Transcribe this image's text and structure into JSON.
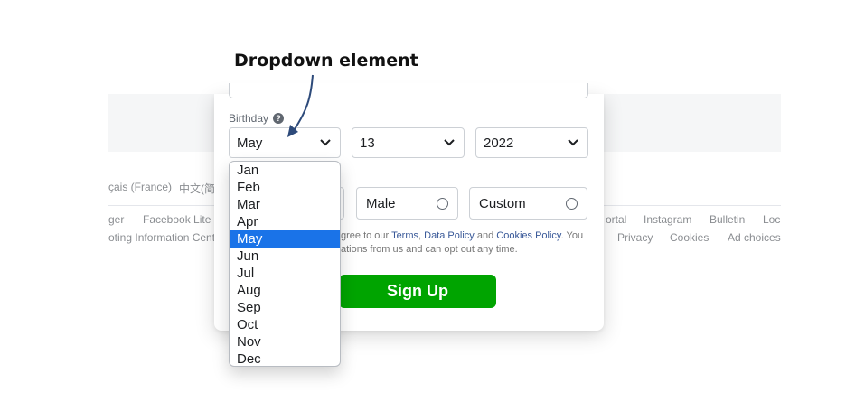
{
  "annotation": {
    "title": "Dropdown element"
  },
  "background": {
    "language_links": [
      "çais (France)",
      "中文(简"
    ],
    "footer_row1": [
      "ger",
      "Facebook Lite",
      "ortal",
      "Instagram",
      "Bulletin",
      "Loc"
    ],
    "footer_row2": [
      "oting Information Cent",
      "Privacy",
      "Cookies",
      "Ad choices"
    ]
  },
  "form": {
    "birthday_label": "Birthday",
    "help_icon_text": "?",
    "month_value": "May",
    "day_value": "13",
    "year_value": "2022",
    "gender_options": {
      "male": "Male",
      "custom": "Custom"
    },
    "terms": {
      "part1": "gree to our",
      "terms_link": "Terms",
      "sep": ",",
      "data_policy_link": "Data Policy",
      "and": "and",
      "cookies_link": "Cookies Policy",
      "part2": ". You",
      "line2": "ations from us and can opt out any time."
    },
    "signup_label": "Sign Up",
    "signup_color": "#00a400"
  },
  "dropdown": {
    "options": [
      "Jan",
      "Feb",
      "Mar",
      "Apr",
      "May",
      "Jun",
      "Jul",
      "Aug",
      "Sep",
      "Oct",
      "Nov",
      "Dec"
    ],
    "selected": "May",
    "highlight_color": "#1a73e8"
  }
}
